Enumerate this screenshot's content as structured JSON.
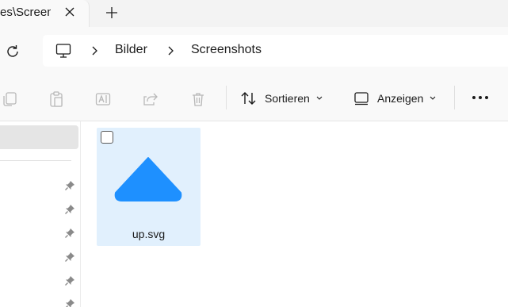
{
  "tabs": [
    {
      "title": "es\\Screenshots"
    }
  ],
  "new_tab_label": "+",
  "breadcrumb": {
    "items": [
      {
        "label": "Bilder"
      },
      {
        "label": "Screenshots"
      }
    ]
  },
  "commandbar": {
    "toolbar_icons": [
      "copy-icon",
      "paste-icon",
      "rename-icon",
      "share-icon",
      "delete-icon"
    ],
    "sort_label": "Sortieren",
    "view_label": "Anzeigen",
    "more_label": "..."
  },
  "navpane": {
    "pinned_count": 6
  },
  "files": [
    {
      "name": "up.svg",
      "selected": true,
      "checked": false,
      "thumbnail": "blue-up-triangle",
      "color": "#1e90ff"
    }
  ],
  "colors": {
    "accent": "#1e90ff",
    "selection": "#e1f0fd"
  }
}
